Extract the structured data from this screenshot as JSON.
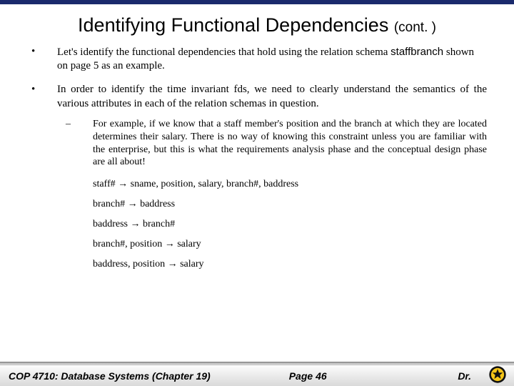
{
  "title": {
    "main": "Identifying Functional Dependencies",
    "cont": "(cont. )"
  },
  "bullets": [
    {
      "pre": "Let's identify the functional dependencies that hold using the relation schema ",
      "schema": "staffbranch",
      "post": " shown on page 5 as an example."
    },
    {
      "text": "In order to identify the time invariant fds, we need to clearly understand the semantics of the various attributes in each of the relation schemas in question."
    }
  ],
  "sub": {
    "text": "For example, if we know that a staff member's position and the branch at which they are located determines their salary.  There is no way of knowing this constraint unless you are familiar with the enterprise, but this is what the requirements analysis phase and the conceptual design phase are all about!"
  },
  "fds": [
    {
      "lhs": "staff#",
      "rhs": "sname, position, salary, branch#, baddress"
    },
    {
      "lhs": "branch#",
      "rhs": "baddress"
    },
    {
      "lhs": "baddress",
      "rhs": "branch#"
    },
    {
      "lhs": "branch#, position",
      "rhs": "salary"
    },
    {
      "lhs": "baddress, position",
      "rhs": "salary"
    }
  ],
  "footer": {
    "course": "COP 4710: Database Systems  (Chapter 19)",
    "page": "Page 46",
    "author": "Dr."
  },
  "arrow": " → "
}
